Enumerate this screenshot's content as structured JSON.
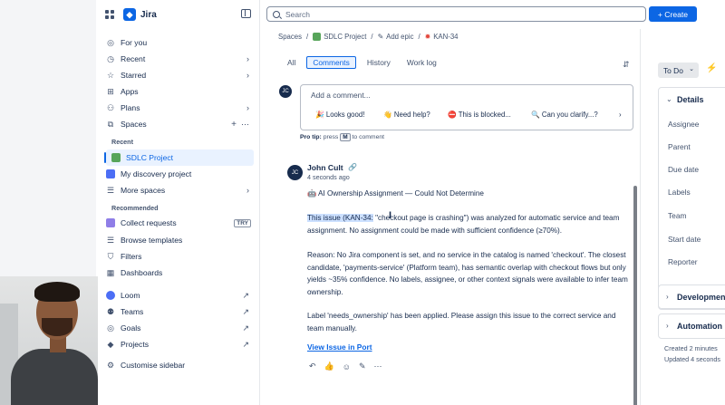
{
  "app": {
    "name": "Jira"
  },
  "sidebar": {
    "items": [
      {
        "label": "For you",
        "icon": "user-circle-icon"
      },
      {
        "label": "Recent",
        "icon": "clock-icon"
      },
      {
        "label": "Starred",
        "icon": "star-icon"
      },
      {
        "label": "Apps",
        "icon": "apps-icon"
      },
      {
        "label": "Plans",
        "icon": "plans-icon"
      },
      {
        "label": "Spaces",
        "icon": "spaces-icon"
      }
    ],
    "recent_heading": "Recent",
    "recent": [
      {
        "label": "SDLC Project",
        "selected": true
      },
      {
        "label": "My discovery project",
        "selected": false
      },
      {
        "label": "More spaces",
        "selected": false
      }
    ],
    "recommended_heading": "Recommended",
    "recommended": [
      {
        "label": "Collect requests",
        "badge": "TRY"
      },
      {
        "label": "Browse templates"
      }
    ],
    "bottom": [
      {
        "label": "Filters"
      },
      {
        "label": "Dashboards"
      },
      {
        "label": "Loom"
      },
      {
        "label": "Teams"
      },
      {
        "label": "Goals"
      },
      {
        "label": "Projects"
      },
      {
        "label": "Customise sidebar"
      }
    ]
  },
  "topbar": {
    "search_placeholder": "Search",
    "create_label": "+ Create"
  },
  "breadcrumbs": [
    "Spaces",
    "SDLC Project",
    "Add epic",
    "KAN-34"
  ],
  "activity_tabs": [
    {
      "label": "All",
      "active": false
    },
    {
      "label": "Comments",
      "active": true
    },
    {
      "label": "History",
      "active": false
    },
    {
      "label": "Work log",
      "active": false
    }
  ],
  "comment_editor": {
    "avatar_initials": "JC",
    "placeholder": "Add a comment...",
    "quick_replies": [
      "🎉 Looks good!",
      "👋 Need help?",
      "⛔ This is blocked...",
      "🔍 Can you clarify...?"
    ],
    "pro_tip_label": "Pro tip:",
    "pro_tip_pre": "press",
    "pro_tip_key": "M",
    "pro_tip_post": "to comment"
  },
  "comment": {
    "avatar_initials": "JC",
    "author": "John Cult",
    "time": "4 seconds ago",
    "heading": "🤖 AI Ownership Assignment — Could Not Determine",
    "para1_highlight": "This issue (KAN-34:",
    "para1_rest": " \"checkout page is crashing\") was analyzed for automatic service and team assignment. No assignment could be made with sufficient confidence (≥70%).",
    "para2": "Reason: No Jira component is set, and no service in the catalog is named 'checkout'. The closest candidate, 'payments-service' (Platform team), has semantic overlap with checkout flows but only yields ~35% confidence. No labels, assignee, or other context signals were available to infer team ownership.",
    "para3": "Label 'needs_ownership' has been applied. Please assign this issue to the correct service and team manually.",
    "link": "View Issue in Port"
  },
  "right_panel": {
    "status": "To Do",
    "details_heading": "Details",
    "fields": [
      "Assignee",
      "Parent",
      "Due date",
      "Labels",
      "Team",
      "Start date",
      "Reporter"
    ],
    "development_heading": "Development",
    "automation_heading": "Automation",
    "created": "Created 2 minutes",
    "updated": "Updated 4 seconds"
  },
  "colors": {
    "accent": "#0c66e4",
    "highlight": "#cce0ff",
    "text": "#172b4d"
  }
}
